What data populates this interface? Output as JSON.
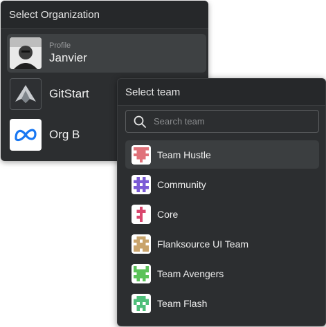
{
  "org_panel": {
    "title": "Select Organization",
    "items": [
      {
        "sub": "Profile",
        "name": "Janvier",
        "selected": true
      },
      {
        "name": "GitStart"
      },
      {
        "name": "Org B"
      }
    ]
  },
  "team_panel": {
    "title": "Select team",
    "search": {
      "placeholder": "Search team",
      "value": ""
    },
    "items": [
      {
        "name": "Team Hustle",
        "color": "#e0727a",
        "selected": true
      },
      {
        "name": "Community",
        "color": "#7b5bd6"
      },
      {
        "name": "Core",
        "color": "#d9476e"
      },
      {
        "name": "Flanksource UI Team",
        "color": "#c9a46c"
      },
      {
        "name": "Team Avengers",
        "color": "#5cc25a"
      },
      {
        "name": "Team Flash",
        "color": "#4fbf7a"
      }
    ]
  }
}
